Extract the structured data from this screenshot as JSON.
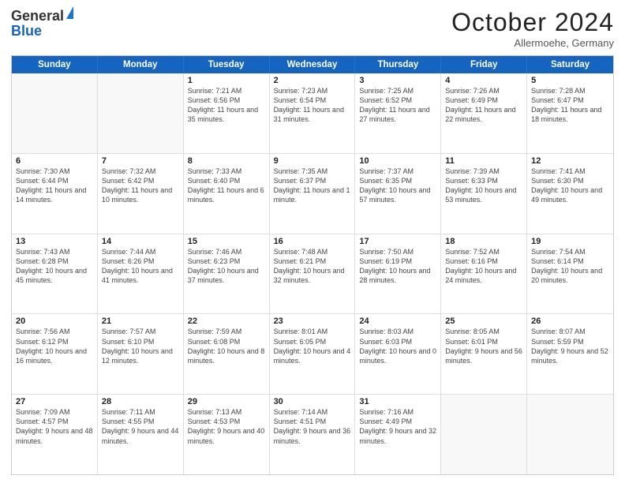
{
  "header": {
    "logo_line1": "General",
    "logo_line2": "Blue",
    "month": "October 2024",
    "location": "Allermoehe, Germany"
  },
  "weekdays": [
    "Sunday",
    "Monday",
    "Tuesday",
    "Wednesday",
    "Thursday",
    "Friday",
    "Saturday"
  ],
  "weeks": [
    [
      {
        "day": "",
        "info": ""
      },
      {
        "day": "",
        "info": ""
      },
      {
        "day": "1",
        "info": "Sunrise: 7:21 AM\nSunset: 6:56 PM\nDaylight: 11 hours and 35 minutes."
      },
      {
        "day": "2",
        "info": "Sunrise: 7:23 AM\nSunset: 6:54 PM\nDaylight: 11 hours and 31 minutes."
      },
      {
        "day": "3",
        "info": "Sunrise: 7:25 AM\nSunset: 6:52 PM\nDaylight: 11 hours and 27 minutes."
      },
      {
        "day": "4",
        "info": "Sunrise: 7:26 AM\nSunset: 6:49 PM\nDaylight: 11 hours and 22 minutes."
      },
      {
        "day": "5",
        "info": "Sunrise: 7:28 AM\nSunset: 6:47 PM\nDaylight: 11 hours and 18 minutes."
      }
    ],
    [
      {
        "day": "6",
        "info": "Sunrise: 7:30 AM\nSunset: 6:44 PM\nDaylight: 11 hours and 14 minutes."
      },
      {
        "day": "7",
        "info": "Sunrise: 7:32 AM\nSunset: 6:42 PM\nDaylight: 11 hours and 10 minutes."
      },
      {
        "day": "8",
        "info": "Sunrise: 7:33 AM\nSunset: 6:40 PM\nDaylight: 11 hours and 6 minutes."
      },
      {
        "day": "9",
        "info": "Sunrise: 7:35 AM\nSunset: 6:37 PM\nDaylight: 11 hours and 1 minute."
      },
      {
        "day": "10",
        "info": "Sunrise: 7:37 AM\nSunset: 6:35 PM\nDaylight: 10 hours and 57 minutes."
      },
      {
        "day": "11",
        "info": "Sunrise: 7:39 AM\nSunset: 6:33 PM\nDaylight: 10 hours and 53 minutes."
      },
      {
        "day": "12",
        "info": "Sunrise: 7:41 AM\nSunset: 6:30 PM\nDaylight: 10 hours and 49 minutes."
      }
    ],
    [
      {
        "day": "13",
        "info": "Sunrise: 7:43 AM\nSunset: 6:28 PM\nDaylight: 10 hours and 45 minutes."
      },
      {
        "day": "14",
        "info": "Sunrise: 7:44 AM\nSunset: 6:26 PM\nDaylight: 10 hours and 41 minutes."
      },
      {
        "day": "15",
        "info": "Sunrise: 7:46 AM\nSunset: 6:23 PM\nDaylight: 10 hours and 37 minutes."
      },
      {
        "day": "16",
        "info": "Sunrise: 7:48 AM\nSunset: 6:21 PM\nDaylight: 10 hours and 32 minutes."
      },
      {
        "day": "17",
        "info": "Sunrise: 7:50 AM\nSunset: 6:19 PM\nDaylight: 10 hours and 28 minutes."
      },
      {
        "day": "18",
        "info": "Sunrise: 7:52 AM\nSunset: 6:16 PM\nDaylight: 10 hours and 24 minutes."
      },
      {
        "day": "19",
        "info": "Sunrise: 7:54 AM\nSunset: 6:14 PM\nDaylight: 10 hours and 20 minutes."
      }
    ],
    [
      {
        "day": "20",
        "info": "Sunrise: 7:56 AM\nSunset: 6:12 PM\nDaylight: 10 hours and 16 minutes."
      },
      {
        "day": "21",
        "info": "Sunrise: 7:57 AM\nSunset: 6:10 PM\nDaylight: 10 hours and 12 minutes."
      },
      {
        "day": "22",
        "info": "Sunrise: 7:59 AM\nSunset: 6:08 PM\nDaylight: 10 hours and 8 minutes."
      },
      {
        "day": "23",
        "info": "Sunrise: 8:01 AM\nSunset: 6:05 PM\nDaylight: 10 hours and 4 minutes."
      },
      {
        "day": "24",
        "info": "Sunrise: 8:03 AM\nSunset: 6:03 PM\nDaylight: 10 hours and 0 minutes."
      },
      {
        "day": "25",
        "info": "Sunrise: 8:05 AM\nSunset: 6:01 PM\nDaylight: 9 hours and 56 minutes."
      },
      {
        "day": "26",
        "info": "Sunrise: 8:07 AM\nSunset: 5:59 PM\nDaylight: 9 hours and 52 minutes."
      }
    ],
    [
      {
        "day": "27",
        "info": "Sunrise: 7:09 AM\nSunset: 4:57 PM\nDaylight: 9 hours and 48 minutes."
      },
      {
        "day": "28",
        "info": "Sunrise: 7:11 AM\nSunset: 4:55 PM\nDaylight: 9 hours and 44 minutes."
      },
      {
        "day": "29",
        "info": "Sunrise: 7:13 AM\nSunset: 4:53 PM\nDaylight: 9 hours and 40 minutes."
      },
      {
        "day": "30",
        "info": "Sunrise: 7:14 AM\nSunset: 4:51 PM\nDaylight: 9 hours and 36 minutes."
      },
      {
        "day": "31",
        "info": "Sunrise: 7:16 AM\nSunset: 4:49 PM\nDaylight: 9 hours and 32 minutes."
      },
      {
        "day": "",
        "info": ""
      },
      {
        "day": "",
        "info": ""
      }
    ]
  ]
}
